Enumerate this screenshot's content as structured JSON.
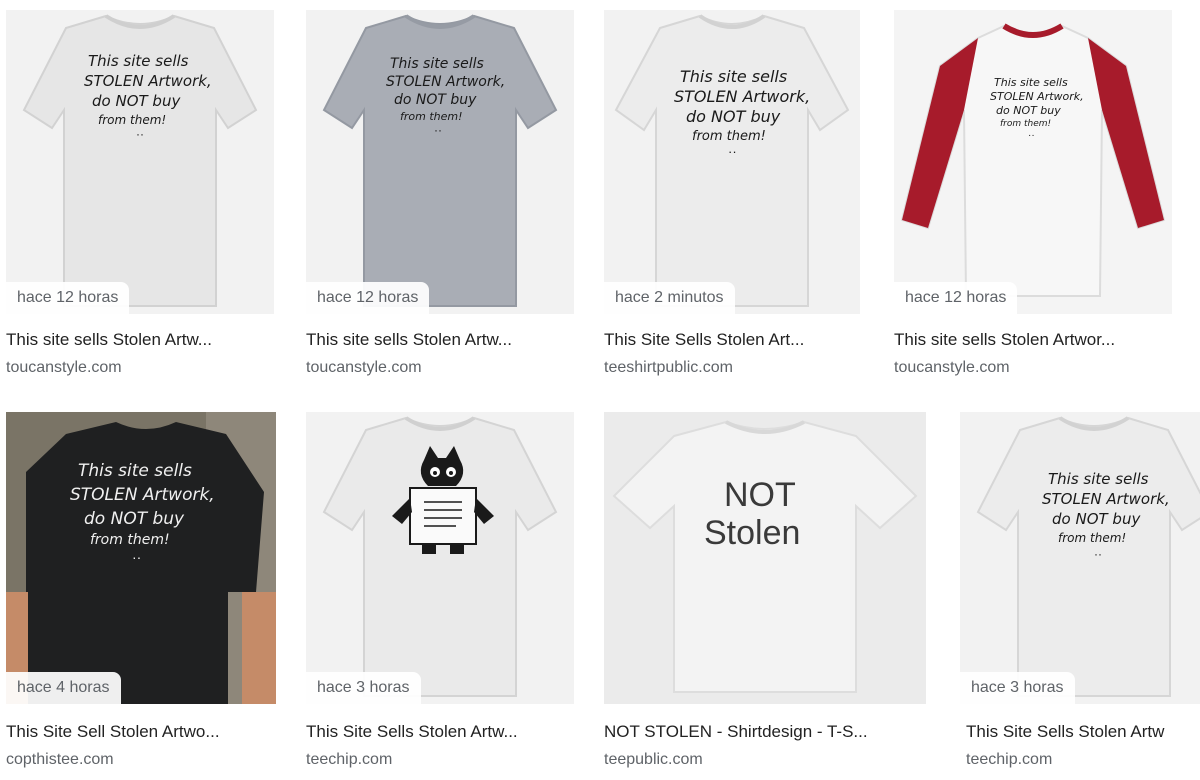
{
  "results": [
    {
      "time": "hace 12 horas",
      "title": "This site sells Stolen Artw...",
      "source": "toucanstyle.com"
    },
    {
      "time": "hace 12 horas",
      "title": "This site sells Stolen Artw...",
      "source": "toucanstyle.com"
    },
    {
      "time": "hace 2 minutos",
      "title": "This Site Sells Stolen Art...",
      "source": "teeshirtpublic.com"
    },
    {
      "time": "hace 12 horas",
      "title": "This site sells Stolen Artwor...",
      "source": "toucanstyle.com"
    },
    {
      "time": "hace 4 horas",
      "title": "This Site Sell Stolen Artwo...",
      "source": "copthistee.com"
    },
    {
      "time": "hace 3 horas",
      "title": "This Site Sells Stolen Artw...",
      "source": "teechip.com"
    },
    {
      "time": "",
      "title": "NOT STOLEN - Shirtdesign - T-S...",
      "source": "teepublic.com"
    },
    {
      "time": "hace 3 horas",
      "title": "This Site Sells Stolen Artw",
      "source": "teechip.com"
    }
  ],
  "shirt_text": {
    "line1": "This site sells",
    "line2": "STOLEN Artwork,",
    "line3": "do NOT buy",
    "line4": "from them!",
    "face": "··"
  },
  "not_stolen": {
    "line1": "NOT",
    "line2": "Stolen"
  },
  "colors": {
    "shirt_light": "#e9e9e9",
    "shirt_grey": "#a8acb4",
    "shirt_white": "#f6f6f6",
    "sleeve_red": "#a71b2b",
    "shirt_black": "#1f2021",
    "ink": "#1a1a1a"
  }
}
